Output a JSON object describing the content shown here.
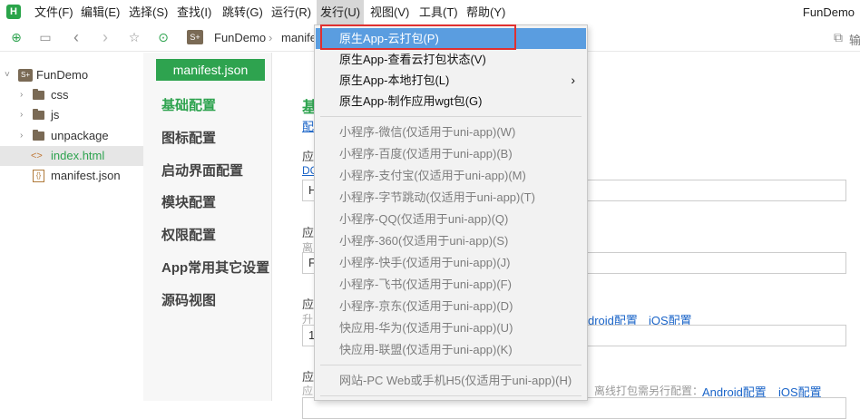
{
  "app": {
    "logo_letter": "H",
    "window_title": "FunDemo"
  },
  "menubar": {
    "items": [
      "文件(F)",
      "编辑(E)",
      "选择(S)",
      "查找(I)",
      "跳转(G)",
      "运行(R)",
      "发行(U)",
      "视图(V)",
      "工具(T)",
      "帮助(Y)"
    ]
  },
  "toolbar": {
    "breadcrumb_icon": "S+",
    "breadcrumb_project": "FunDemo",
    "breadcrumb_file": "manife",
    "right_text": "输"
  },
  "sidebar": {
    "project": "FunDemo",
    "items": [
      {
        "label": "css",
        "type": "folder"
      },
      {
        "label": "js",
        "type": "folder"
      },
      {
        "label": "unpackage",
        "type": "folder"
      },
      {
        "label": "index.html",
        "type": "html",
        "selected": true
      },
      {
        "label": "manifest.json",
        "type": "json"
      }
    ]
  },
  "settings_nav": {
    "tab_label": "manifest.json",
    "items": [
      "基础配置",
      "图标配置",
      "启动界面配置",
      "模块配置",
      "权限配置",
      "App常用其它设置",
      "源码视图"
    ],
    "active_index": 0
  },
  "content": {
    "section_title_fragment": "基",
    "link_fragment": "配",
    "field1_label": "应",
    "field1_sub": "DC",
    "field1_value": "H",
    "field2_label": "应",
    "field2_sub": "离",
    "field2_value": "F",
    "field3_label": "应",
    "field3_sub": "升",
    "field3_value": "1",
    "field3_link_android": "droid配置",
    "field3_link_ios": "iOS配置",
    "field4_label": "应",
    "field4_sub": "应",
    "field4_note": "离线打包需另行配置：",
    "field4_link_android": "Android配置",
    "field4_link_ios": "iOS配置"
  },
  "dropdown": {
    "group1": [
      {
        "label": "原生App-云打包(P)",
        "highlight": true
      },
      {
        "label": "原生App-查看云打包状态(V)"
      },
      {
        "label": "原生App-本地打包(L)",
        "submenu": true
      },
      {
        "label": "原生App-制作应用wgt包(G)"
      }
    ],
    "group2": [
      "小程序-微信(仅适用于uni-app)(W)",
      "小程序-百度(仅适用于uni-app)(B)",
      "小程序-支付宝(仅适用于uni-app)(M)",
      "小程序-字节跳动(仅适用于uni-app)(T)",
      "小程序-QQ(仅适用于uni-app)(Q)",
      "小程序-360(仅适用于uni-app)(S)",
      "小程序-快手(仅适用于uni-app)(J)",
      "小程序-飞书(仅适用于uni-app)(F)",
      "小程序-京东(仅适用于uni-app)(D)",
      "快应用-华为(仅适用于uni-app)(U)",
      "快应用-联盟(仅适用于uni-app)(K)"
    ],
    "group3": [
      "网站-PC Web或手机H5(仅适用于uni-app)(H)"
    ]
  },
  "colors": {
    "accent_green": "#2ea34f",
    "highlight_blue": "#5a9de0",
    "callout_red": "#e03030",
    "link_blue": "#1a64c8"
  }
}
